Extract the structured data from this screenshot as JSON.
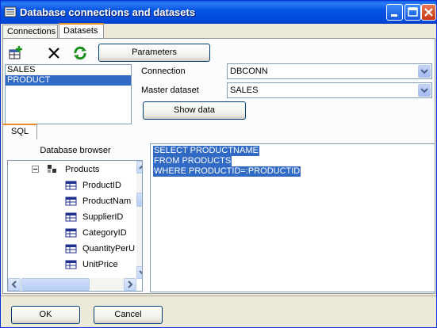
{
  "window": {
    "title": "Database connections and datasets"
  },
  "tabs": [
    {
      "label": "Connections",
      "active": false
    },
    {
      "label": "Datasets",
      "active": true
    }
  ],
  "toolbar": {
    "add_icon": "add-dataset-icon",
    "delete_icon": "delete-icon",
    "refresh_icon": "refresh-icon",
    "parameters_label": "Parameters"
  },
  "datasets": [
    {
      "name": "SALES",
      "selected": false
    },
    {
      "name": "PRODUCT",
      "selected": true
    }
  ],
  "form": {
    "connection_label": "Connection",
    "connection_value": "DBCONN",
    "master_label": "Master dataset",
    "master_value": "SALES",
    "show_data_label": "Show data"
  },
  "sql_tab": "SQL",
  "browser": {
    "title": "Database browser",
    "table": "Products",
    "fields": [
      "ProductID",
      "ProductNam",
      "SupplierID",
      "CategoryID",
      "QuantityPerU",
      "UnitPrice"
    ]
  },
  "sql": [
    "SELECT PRODUCTNAME",
    "FROM PRODUCTS",
    "WHERE PRODUCTID=:PRODUCTID"
  ],
  "buttons": {
    "ok": "OK",
    "cancel": "Cancel"
  },
  "colors": {
    "titlebar": "#0048d8",
    "selection": "#316ac5",
    "face": "#ece9d8"
  }
}
